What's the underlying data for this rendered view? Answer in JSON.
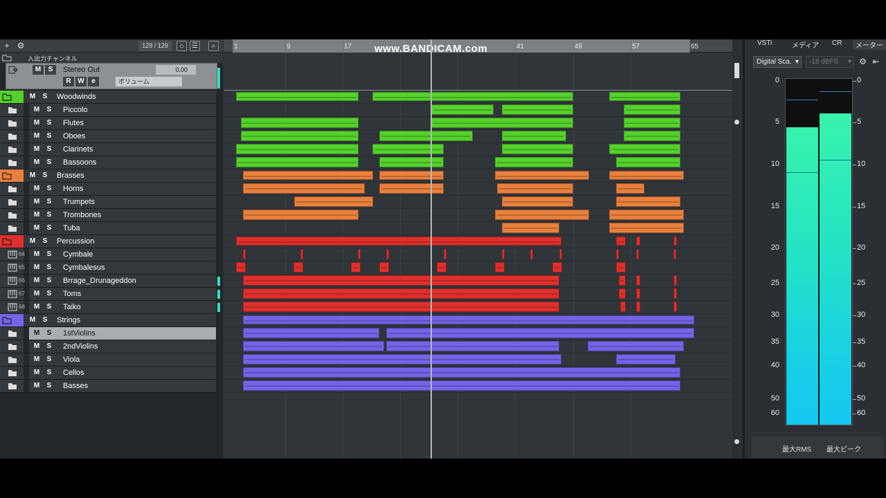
{
  "header": {
    "track_count": "129 / 129"
  },
  "io_folder": {
    "label": "入出力チャンネル"
  },
  "stereo_out": {
    "name": "Stereo Out",
    "mute": "M",
    "solo": "S",
    "read": "R",
    "write": "W",
    "edit": "e",
    "volume": "0.00",
    "param": "ボリューム"
  },
  "tracks": [
    {
      "name": "Woodwinds",
      "type": "folder",
      "color": "#55d12b"
    },
    {
      "name": "Piccolo",
      "type": "child"
    },
    {
      "name": "Flutes",
      "type": "child"
    },
    {
      "name": "Oboes",
      "type": "child"
    },
    {
      "name": "Clarinets",
      "type": "child"
    },
    {
      "name": "Bassoons",
      "type": "child"
    },
    {
      "name": "Brasses",
      "type": "folder",
      "color": "#e9803c"
    },
    {
      "name": "Horns",
      "type": "child"
    },
    {
      "name": "Trumpets",
      "type": "child"
    },
    {
      "name": "Trombones",
      "type": "child"
    },
    {
      "name": "Tuba",
      "type": "child"
    },
    {
      "name": "Percussion",
      "type": "folder",
      "color": "#e0302c"
    },
    {
      "name": "Cymbale",
      "type": "child",
      "num": "64"
    },
    {
      "name": "Cymbalesus",
      "type": "child",
      "num": "65"
    },
    {
      "name": "Brrage_Drunageddon",
      "type": "child",
      "num": "66"
    },
    {
      "name": "Toms",
      "type": "child",
      "num": "67"
    },
    {
      "name": "Taiko",
      "type": "child",
      "num": "68"
    },
    {
      "name": "Strings",
      "type": "folder",
      "color": "#7464e8"
    },
    {
      "name": "1stViolins",
      "type": "child",
      "selected": true
    },
    {
      "name": "2ndViolins",
      "type": "child"
    },
    {
      "name": "Viola",
      "type": "child"
    },
    {
      "name": "Cellos",
      "type": "child"
    },
    {
      "name": "Basses",
      "type": "child"
    }
  ],
  "mute_label": "M",
  "solo_label": "S",
  "ruler": {
    "bars": [
      "1",
      "9",
      "17",
      "41",
      "49",
      "57",
      "65"
    ],
    "watermark": "www.BANDICAM.com"
  },
  "right_panel": {
    "tabs": [
      "VSTi",
      "メディア",
      "CR",
      "メーター"
    ],
    "scale": "Digital Sca.",
    "reference": "-18 dBFS",
    "scale_marks": [
      "0",
      "5",
      "10",
      "15",
      "20",
      "25",
      "30",
      "35",
      "40",
      "50",
      "60"
    ],
    "meter_left_level": 0.86,
    "meter_right_level": 0.9,
    "footer_rms": "最大RMS",
    "footer_peak": "最大ピーク"
  },
  "colors": {
    "woodwinds": "#55d12b",
    "brasses": "#e9803c",
    "percussion": "#e0302c",
    "strings": "#7464e8"
  }
}
